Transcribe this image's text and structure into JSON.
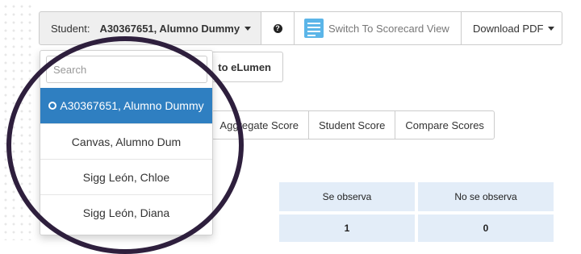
{
  "toolbar": {
    "student_label": "Student:",
    "student_value": "A30367651, Alumno Dummy",
    "help_glyph": "?",
    "scorecard_label": "Switch To Scorecard View",
    "pdf_label": "Download PDF"
  },
  "elumen_button": "to eLumen",
  "tabs": [
    "Aggregate Score",
    "Student Score",
    "Compare Scores"
  ],
  "results": {
    "headers": [
      "Se observa",
      "No se observa"
    ],
    "values": [
      "1",
      "0"
    ]
  },
  "dropdown": {
    "search_placeholder": "Search",
    "items": [
      {
        "label": "A30367651, Alumno Dummy",
        "selected": true
      },
      {
        "label": "Canvas, Alumno Dum",
        "selected": false
      },
      {
        "label": "Sigg León, Chloe",
        "selected": false
      },
      {
        "label": "Sigg León, Diana",
        "selected": false
      }
    ]
  },
  "colors": {
    "selected_item_bg": "#2f7fc1",
    "status_dot": "#3aa848",
    "table_cell_bg": "#e3edf8",
    "annotation_ring": "#2e1f3d"
  }
}
